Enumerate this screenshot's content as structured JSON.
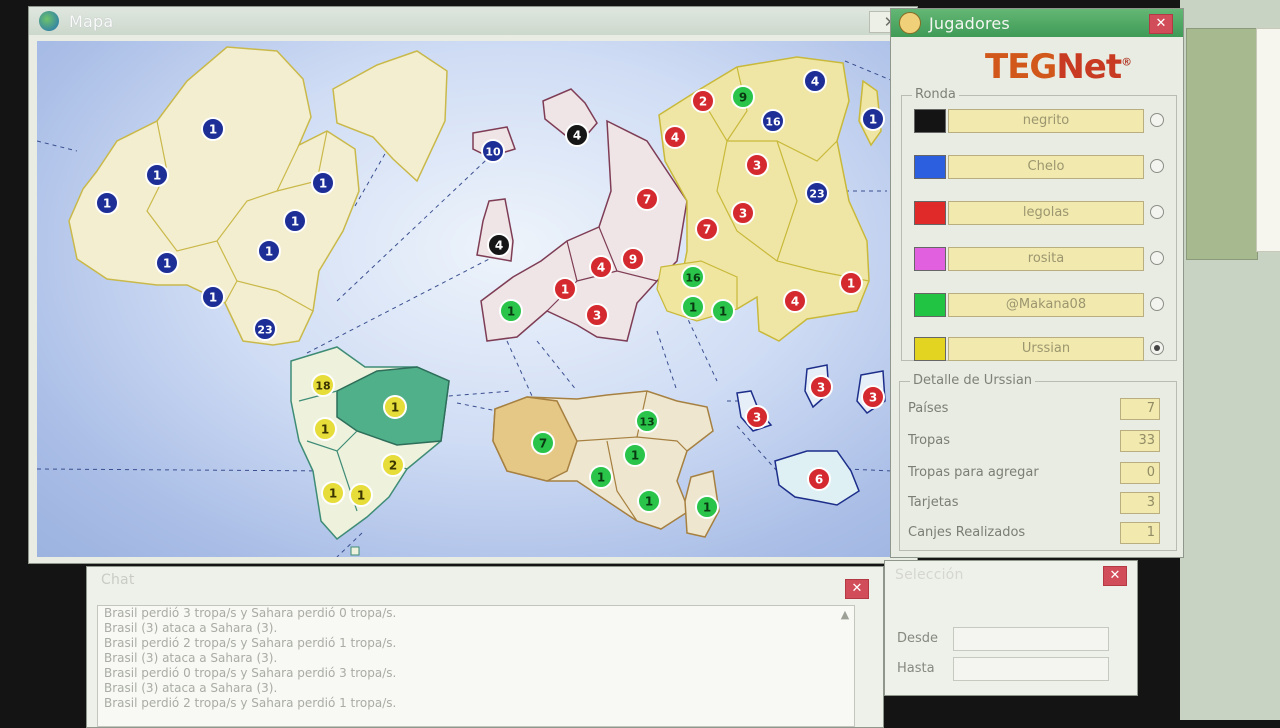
{
  "map_window": {
    "title": "Mapa",
    "close_glyph": "✕"
  },
  "players_window": {
    "title": "Jugadores",
    "close_glyph": "✕"
  },
  "brand": {
    "part1": "TEG",
    "part2": "Net",
    "mark": "®"
  },
  "round": {
    "label": "Ronda",
    "players": [
      {
        "name": "negrito",
        "color": "#141414",
        "selected": false
      },
      {
        "name": "Chelo",
        "color": "#2b5fe0",
        "selected": false
      },
      {
        "name": "legolas",
        "color": "#e02a2a",
        "selected": false
      },
      {
        "name": "rosita",
        "color": "#e060e0",
        "selected": false
      },
      {
        "name": "@Makana08",
        "color": "#22c444",
        "selected": false
      },
      {
        "name": "Urssian",
        "color": "#e2d420",
        "selected": true
      }
    ]
  },
  "details": {
    "label": "Detalle de Urssian",
    "rows": [
      {
        "label": "Países",
        "value": "7"
      },
      {
        "label": "Tropas",
        "value": "33"
      },
      {
        "label": "Tropas para agregar",
        "value": "0"
      },
      {
        "label": "Tarjetas",
        "value": "3"
      },
      {
        "label": "Canjes Realizados",
        "value": "1"
      }
    ]
  },
  "chat": {
    "title": "Chat",
    "close_glyph": "✕",
    "lines": [
      "Brasil perdió 3 tropa/s y Sahara perdió 0 tropa/s.",
      "Brasil (3) ataca a Sahara (3).",
      "Brasil perdió 2 tropa/s y Sahara perdió 1 tropa/s.",
      "Brasil (3) ataca a Sahara (3).",
      "Brasil perdió 0 tropa/s y Sahara perdió 3 tropa/s.",
      "Brasil (3) ataca a Sahara (3).",
      "Brasil perdió 2 tropa/s y Sahara perdió 1 tropa/s."
    ]
  },
  "selection": {
    "title": "Selección",
    "close_glyph": "✕",
    "from_label": "Desde",
    "to_label": "Hasta",
    "from_value": "",
    "to_value": ""
  },
  "troops": [
    {
      "label": "1",
      "color": "blue"
    },
    {
      "label": "1",
      "color": "blue"
    },
    {
      "label": "1",
      "color": "blue"
    },
    {
      "label": "1",
      "color": "blue"
    },
    {
      "label": "1",
      "color": "blue"
    },
    {
      "label": "1",
      "color": "blue"
    },
    {
      "label": "1",
      "color": "blue"
    },
    {
      "label": "1",
      "color": "blue"
    },
    {
      "label": "23",
      "color": "blue"
    },
    {
      "label": "10",
      "color": "blue"
    },
    {
      "label": "4",
      "color": "black"
    },
    {
      "label": "4",
      "color": "black"
    },
    {
      "label": "2",
      "color": "red"
    },
    {
      "label": "9",
      "color": "green"
    },
    {
      "label": "4",
      "color": "blue"
    },
    {
      "label": "16",
      "color": "blue"
    },
    {
      "label": "1",
      "color": "blue"
    },
    {
      "label": "4",
      "color": "red"
    },
    {
      "label": "3",
      "color": "red"
    },
    {
      "label": "23",
      "color": "blue"
    },
    {
      "label": "7",
      "color": "red"
    },
    {
      "label": "3",
      "color": "red"
    },
    {
      "label": "7",
      "color": "red"
    },
    {
      "label": "4",
      "color": "red"
    },
    {
      "label": "9",
      "color": "red"
    },
    {
      "label": "1",
      "color": "red"
    },
    {
      "label": "3",
      "color": "red"
    },
    {
      "label": "16",
      "color": "green"
    },
    {
      "label": "1",
      "color": "green"
    },
    {
      "label": "1",
      "color": "green"
    },
    {
      "label": "1",
      "color": "green"
    },
    {
      "label": "4",
      "color": "red"
    },
    {
      "label": "1",
      "color": "red"
    },
    {
      "label": "18",
      "color": "yellow"
    },
    {
      "label": "1",
      "color": "yellow"
    },
    {
      "label": "1",
      "color": "yellow"
    },
    {
      "label": "2",
      "color": "yellow"
    },
    {
      "label": "1",
      "color": "yellow"
    },
    {
      "label": "1",
      "color": "yellow"
    },
    {
      "label": "7",
      "color": "green"
    },
    {
      "label": "13",
      "color": "green"
    },
    {
      "label": "1",
      "color": "green"
    },
    {
      "label": "1",
      "color": "green"
    },
    {
      "label": "1",
      "color": "green"
    },
    {
      "label": "1",
      "color": "green"
    },
    {
      "label": "3",
      "color": "red"
    },
    {
      "label": "3",
      "color": "red"
    },
    {
      "label": "3",
      "color": "red"
    },
    {
      "label": "6",
      "color": "red"
    }
  ]
}
